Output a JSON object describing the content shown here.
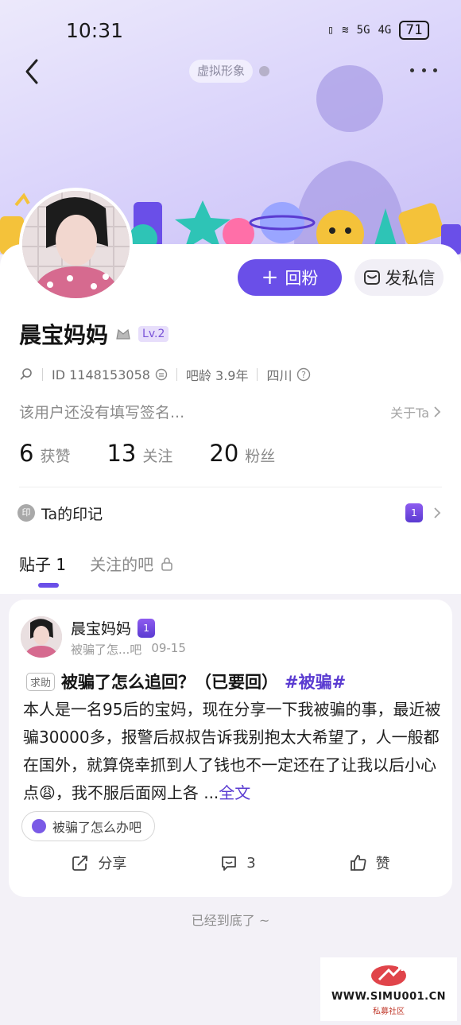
{
  "status_bar": {
    "time": "10:31",
    "signal_5g": "5G",
    "signal_4g": "4G",
    "battery": "71"
  },
  "header": {
    "avatar_tag": "虚拟形象"
  },
  "profile": {
    "name": "晨宝妈妈",
    "level": "Lv.2",
    "id_text": "ID 1148153058",
    "bar_age": "吧龄 3.9年",
    "location": "四川",
    "signature": "该用户还没有填写签名...",
    "about_link": "关于Ta",
    "follow_button": "回粉",
    "message_button": "发私信"
  },
  "stats": [
    {
      "num": "6",
      "label": "获赞"
    },
    {
      "num": "13",
      "label": "关注"
    },
    {
      "num": "20",
      "label": "粉丝"
    }
  ],
  "imprint": {
    "icon_text": "印",
    "label": "Ta的印记",
    "medal": "1"
  },
  "tabs": [
    {
      "label": "贴子 1"
    },
    {
      "label": "关注的吧"
    }
  ],
  "post": {
    "author": "晨宝妈妈",
    "author_medal": "1",
    "forum": "被骗了怎...吧",
    "date": "09-15",
    "tag": "求助",
    "title": "被骗了怎么追回？（已要回）",
    "hashtag": "#被骗#",
    "body": "本人是一名95后的宝妈，现在分享一下我被骗的事，最近被骗30000多，报警后叔叔告诉我别抱太大希望了，人一般都在国外，就算侥幸抓到人了钱也不一定还在了让我以后小心点😩，我不服后面网上各 ...",
    "more": "全文",
    "forum_chip": "被骗了怎么办吧",
    "share": "分享",
    "comments": "3",
    "like": "赞"
  },
  "end_note": "已经到底了 ~",
  "watermark": {
    "url": "WWW.SIMU001.CN",
    "sub": "私募社区"
  },
  "colors": {
    "accent": "#6a4fe8",
    "banner": "#d6cff9"
  }
}
